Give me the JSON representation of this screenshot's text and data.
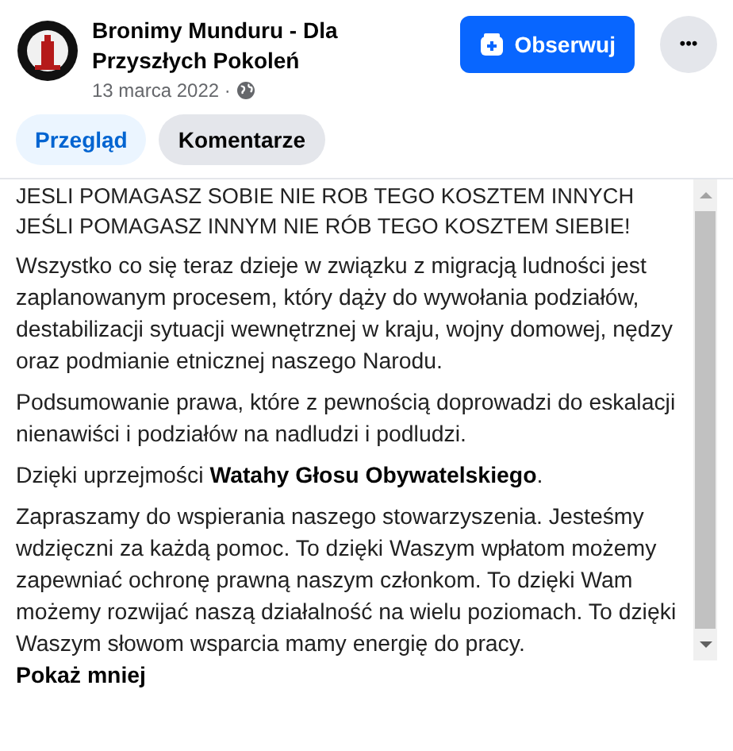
{
  "post": {
    "author": "Bronimy Munduru - Dla Przyszłych Pokoleń",
    "date": "13 marca 2022 ·",
    "follow_button": "Obserwuj",
    "more_button": "•••"
  },
  "tabs": [
    {
      "label": "Przegląd",
      "selected": true
    },
    {
      "label": "Komentarze",
      "selected": false
    }
  ],
  "body": {
    "heading_lines": [
      "JESLI POMAGASZ SOBIE NIE ROB TEGO KOSZTEM INNYCH",
      "JEŚLI POMAGASZ INNYM NIE RÓB TEGO KOSZTEM SIEBIE!"
    ],
    "paragraphs": [
      "Wszystko co się teraz dzieje w związku z migracją ludności jest zaplanowanym procesem, który dąży do wywołania podziałów, destabilizacji sytuacji wewnętrznej w kraju, wojny domowej, nędzy oraz podmianie etnicznej naszego Narodu.",
      "Podsumowanie prawa, które z pewnością doprowadzi do eskalacji nienawiści i podziałów na nadludzi i podludzi.",
      "Dzięki uprzejmości **Watahy Głosu Obywatelskiego**.",
      "Zapraszamy do wspierania naszego stowarzyszenia. Jesteśmy wdzięczni za każdą pomoc. To dzięki Waszym wpłatom możemy zapewniać ochronę prawną naszym członkom. To dzięki Wam możemy rozwijać naszą działalność na wielu poziomach. To dzięki Waszym słowom wsparcia mamy energię do pracy."
    ],
    "show_less": "Pokaż mniej"
  }
}
